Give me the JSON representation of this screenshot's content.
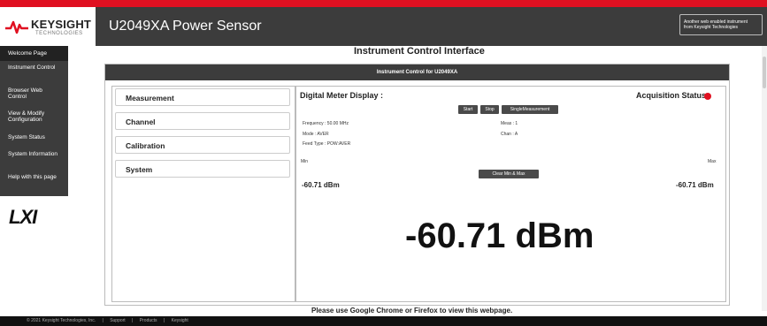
{
  "header": {
    "brand_name": "KEYSIGHT",
    "brand_sub": "TECHNOLOGIES",
    "app_title": "U2049XA Power Sensor",
    "promo_line1": "Another web enabled instrument",
    "promo_line2": "from Keysight Technologies"
  },
  "sidebar": {
    "items": [
      {
        "label": "Welcome Page"
      },
      {
        "label": "Instrument Control"
      },
      {
        "label": "Browser Web Control"
      },
      {
        "label": "View & Modify Configuration"
      },
      {
        "label": "System Status"
      },
      {
        "label": "System Information"
      },
      {
        "label": "Help with this page"
      }
    ],
    "lxi_logo": "LXI"
  },
  "main": {
    "page_title": "Instrument Control Interface",
    "panel_title": "Instrument Control for U2049XA",
    "menu": [
      "Measurement",
      "Channel",
      "Calibration",
      "System"
    ],
    "meter": {
      "title": "Digital Meter Display :",
      "acq_label": "Acquisition Status:",
      "buttons": {
        "start": "Start",
        "stop": "Stop",
        "single": "SingleMeasurement",
        "clear": "Clear Min & Max"
      },
      "frequency": "Frequency : 50.00 MHz",
      "mode": "Mode : AVER",
      "feed_type": "Feed Type : POW:AVER",
      "meas": "Meas : 1",
      "chan": "Chan : A",
      "min_label": "Min",
      "max_label": "Max",
      "min_value": "-60.71 dBm",
      "max_value": "-60.71 dBm",
      "reading": "-60.71 dBm"
    },
    "status_color": "#e01021"
  },
  "notice": "Please use Google Chrome or Firefox to view this webpage.",
  "footer": {
    "copyright": "© 2021 Keysight Technologies, Inc.",
    "links": [
      "Support",
      "Products",
      "Keysight"
    ]
  }
}
